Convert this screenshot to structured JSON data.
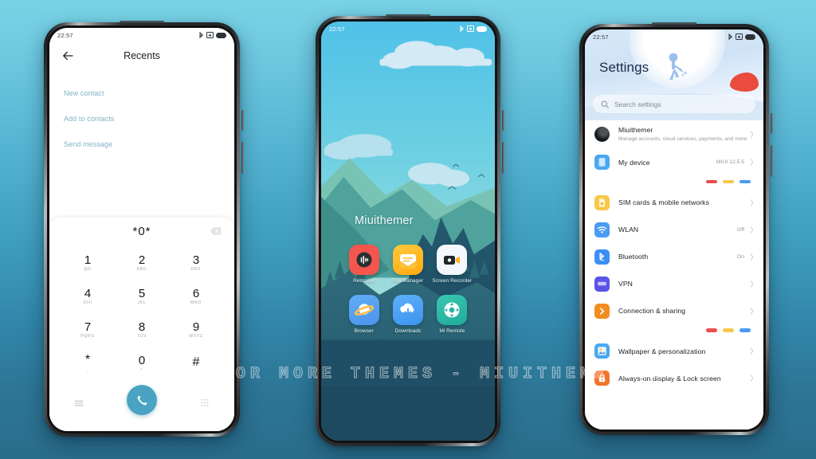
{
  "scene": {
    "background_top": "#79d3e6",
    "background_bottom": "#2a6d8c",
    "watermark": "VISIT FOR MORE THEMES - MIUITHEMER.COM"
  },
  "phone_dialer": {
    "status_bar": {
      "time": "22:57",
      "icons": [
        "bluetooth-icon",
        "alarm-icon",
        "battery-icon"
      ]
    },
    "appbar": {
      "title": "Recents",
      "back_icon": "back-arrow-icon"
    },
    "quick_actions": [
      {
        "label": "New contact"
      },
      {
        "label": "Add to contacts"
      },
      {
        "label": "Send message"
      }
    ],
    "dialpad": {
      "entered_number": "*0*",
      "backspace_icon": "backspace-icon",
      "keys": [
        {
          "digit": "1",
          "letters": "QD"
        },
        {
          "digit": "2",
          "letters": "ABC"
        },
        {
          "digit": "3",
          "letters": "DEF"
        },
        {
          "digit": "4",
          "letters": "GHI"
        },
        {
          "digit": "5",
          "letters": "JKL"
        },
        {
          "digit": "6",
          "letters": "MNO"
        },
        {
          "digit": "7",
          "letters": "PQRS"
        },
        {
          "digit": "8",
          "letters": "TUV"
        },
        {
          "digit": "9",
          "letters": "WXYZ"
        },
        {
          "digit": "*",
          "letters": ","
        },
        {
          "digit": "0",
          "letters": "+"
        },
        {
          "digit": "#",
          "letters": ""
        }
      ],
      "left_icon": "menu-icon",
      "call_icon": "phone-call-icon",
      "right_icon": "dialpad-icon",
      "accent_color": "#4aa3c2"
    }
  },
  "phone_home": {
    "status_bar": {
      "time": "22:57",
      "icons": [
        "bluetooth-icon",
        "alarm-icon",
        "battery-icon"
      ]
    },
    "wallpaper_label": "Miuithemer",
    "apps": [
      {
        "name": "Recorder",
        "icon": "recorder-icon",
        "color": "#f4564d"
      },
      {
        "name": "File Manager",
        "icon": "file-manager-icon",
        "color": "#ffb416"
      },
      {
        "name": "Screen Recorder",
        "icon": "screen-recorder-icon",
        "color": "#f4f7fb"
      },
      {
        "name": "Browser",
        "icon": "browser-icon",
        "color": "#53a1f0"
      },
      {
        "name": "Downloads",
        "icon": "downloads-icon",
        "color": "#4ba3f2"
      },
      {
        "name": "Mi Remote",
        "icon": "mi-remote-icon",
        "color": "#2fb9a6"
      }
    ]
  },
  "phone_settings": {
    "status_bar": {
      "time": "22:57",
      "icons": [
        "bluetooth-icon",
        "alarm-icon",
        "battery-icon"
      ]
    },
    "header": {
      "title": "Settings",
      "illustration": "person-watering-plant-illustration"
    },
    "search": {
      "placeholder": "Search settings",
      "icon": "search-icon"
    },
    "account": {
      "name": "Miuithemer",
      "subtitle": "Manage accounts, cloud services, payments, and more",
      "avatar": "user-avatar"
    },
    "rows": [
      {
        "title": "My device",
        "value": "MIUI 12.5.5",
        "icon": "device-icon",
        "color": "#4aa8f0"
      },
      {
        "title": "SIM cards & mobile networks",
        "value": "",
        "icon": "sim-card-icon",
        "color": "#f7c948"
      },
      {
        "title": "WLAN",
        "value": "Off",
        "icon": "wifi-icon",
        "color": "#4a9bf2"
      },
      {
        "title": "Bluetooth",
        "value": "On",
        "icon": "bluetooth-icon",
        "color": "#3d8ef5"
      },
      {
        "title": "VPN",
        "value": "",
        "icon": "vpn-icon",
        "color": "#5b53e8"
      },
      {
        "title": "Connection & sharing",
        "value": "",
        "icon": "connection-sharing-icon",
        "color": "#f28c20"
      },
      {
        "title": "Wallpaper & personalization",
        "value": "",
        "icon": "wallpaper-icon",
        "color": "#4aa8f0"
      },
      {
        "title": "Always-on display & Lock screen",
        "value": "",
        "icon": "lock-icon",
        "color": "#f2752a"
      }
    ],
    "pill_colors": [
      "#ef4d4d",
      "#f6c84c",
      "#4a9bf2"
    ]
  }
}
